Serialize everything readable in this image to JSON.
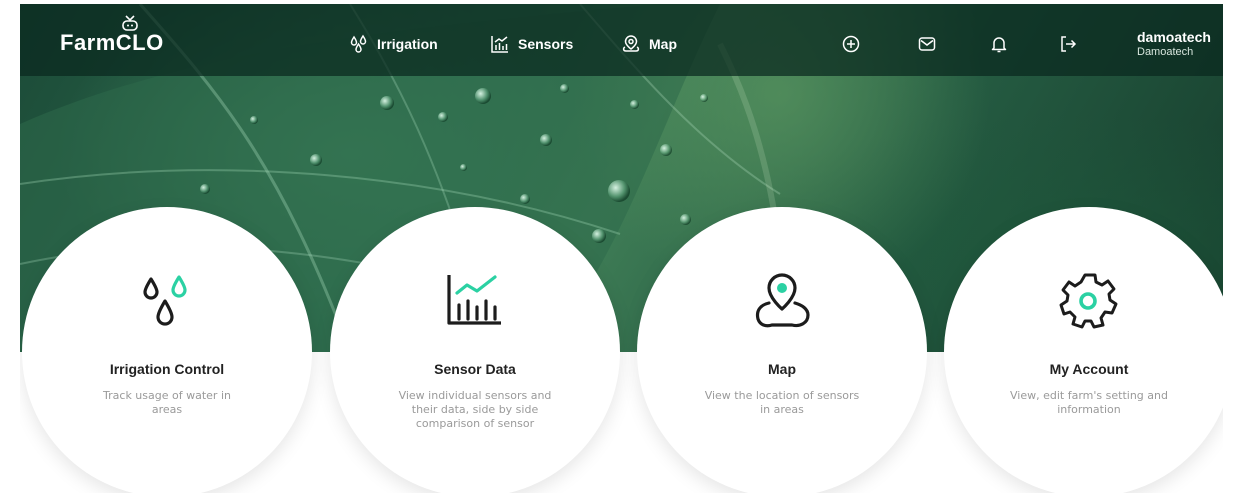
{
  "brand": {
    "name": "FarmCLO"
  },
  "nav": [
    {
      "label": "Irrigation",
      "icon": "droplets-icon"
    },
    {
      "label": "Sensors",
      "icon": "chart-icon"
    },
    {
      "label": "Map",
      "icon": "map-pin-icon"
    }
  ],
  "toolbar": [
    {
      "icon": "plus-circle-icon"
    },
    {
      "icon": "mail-icon"
    },
    {
      "icon": "bell-icon"
    },
    {
      "icon": "logout-icon"
    }
  ],
  "user": {
    "name": "damoatech",
    "org": "Damoatech"
  },
  "accent": "#2bd1a3",
  "cards": [
    {
      "title": "Irrigation Control",
      "desc": "Track usage of water in areas",
      "icon": "droplets-icon"
    },
    {
      "title": "Sensor Data",
      "desc": "View individual sensors and their data, side by side comparison of sensor",
      "icon": "bar-chart-icon"
    },
    {
      "title": "Map",
      "desc": "View the location of sensors in areas",
      "icon": "map-pin-icon"
    },
    {
      "title": "My Account",
      "desc": "View, edit farm's setting and information",
      "icon": "gear-icon"
    }
  ]
}
